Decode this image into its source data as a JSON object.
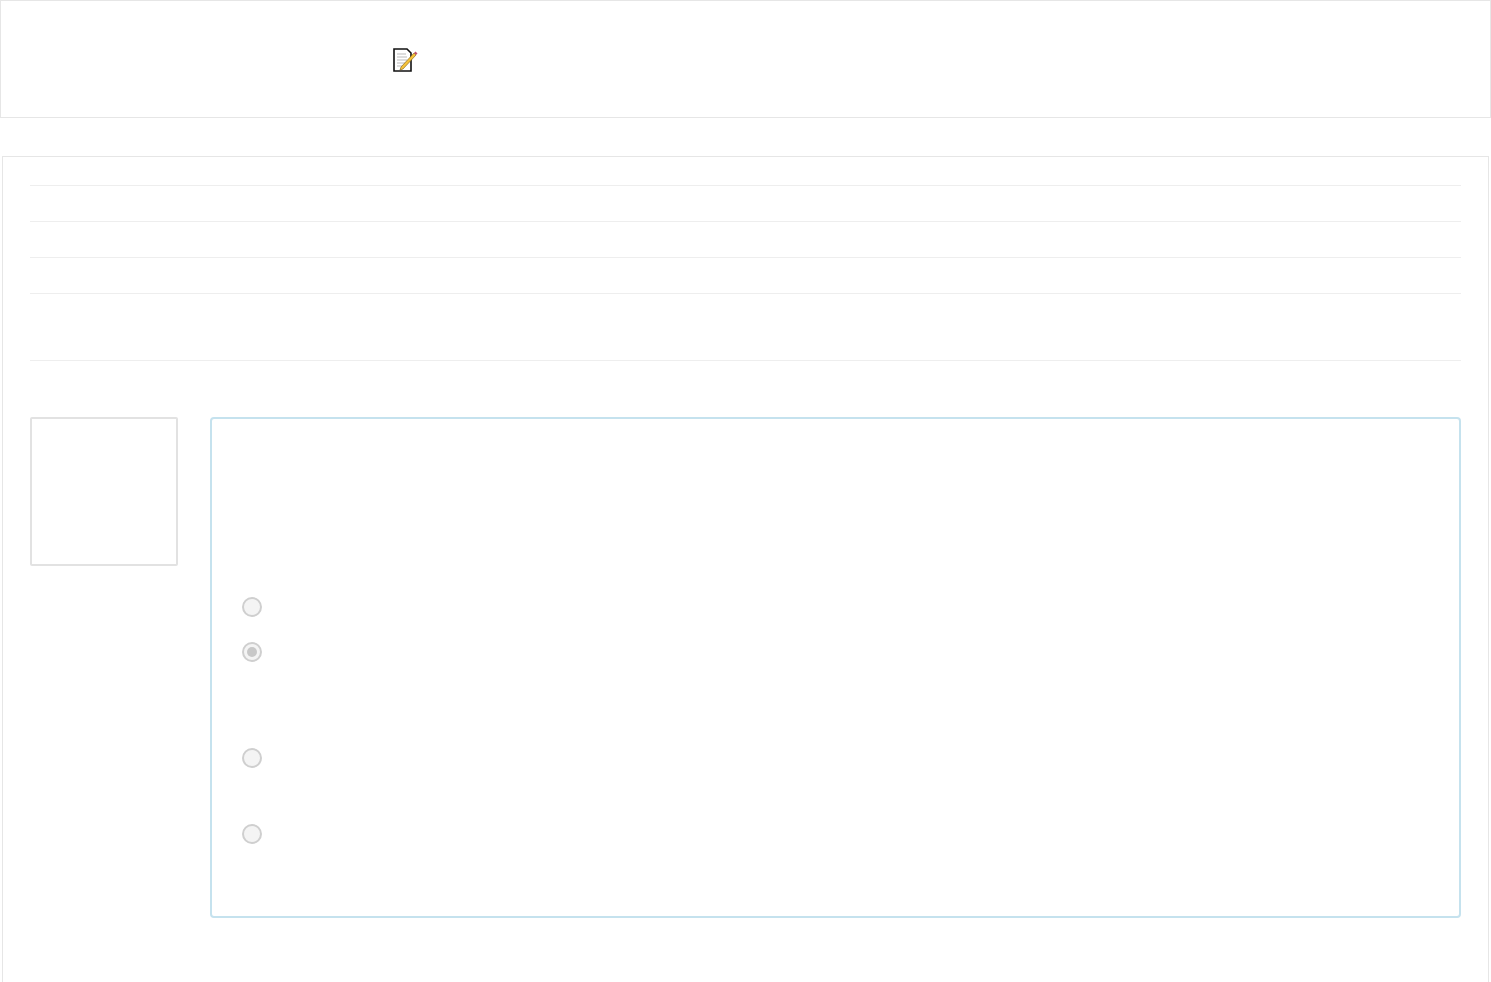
{
  "question": {
    "options": [
      {
        "selected": false
      },
      {
        "selected": true
      },
      {
        "selected": false
      },
      {
        "selected": false
      }
    ]
  }
}
